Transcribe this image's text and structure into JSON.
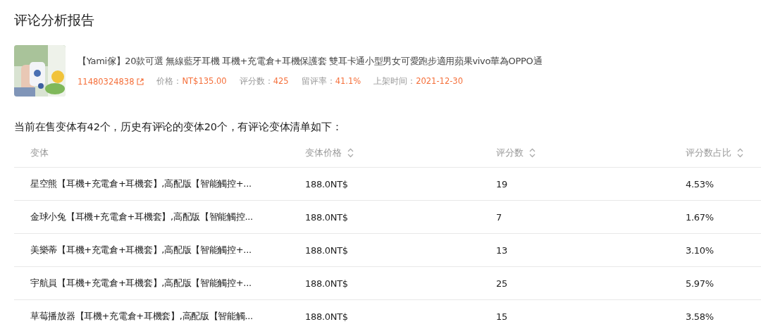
{
  "page_title": "评论分析报告",
  "product": {
    "title": "【Yami傢】20款可選 無線藍牙耳機 耳機+充電倉+耳機保護套 雙耳卡通小型男女可愛跑步適用蘋果vivo華為OPPO通",
    "id": "11480324838",
    "meta": [
      {
        "label": "价格：",
        "value": "NT$135.00"
      },
      {
        "label": "评分数：",
        "value": "425"
      },
      {
        "label": "留评率：",
        "value": "41.1%"
      },
      {
        "label": "上架时间：",
        "value": "2021-12-30"
      }
    ]
  },
  "summary": "当前在售变体有42个，历史有评论的变体20个，有评论变体清单如下：",
  "table": {
    "columns": [
      {
        "label": "变体",
        "sortable": false
      },
      {
        "label": "变体价格",
        "sortable": true
      },
      {
        "label": "评分数",
        "sortable": true
      },
      {
        "label": "评分数占比",
        "sortable": true
      }
    ],
    "rows": [
      [
        "星空熊【耳機+充電倉+耳機套】,高配版【智能觸控+...",
        "188.0NT$",
        "19",
        "4.53%"
      ],
      [
        "金球小兔【耳機+充電倉+耳機套】,高配版【智能觸控...",
        "188.0NT$",
        "7",
        "1.67%"
      ],
      [
        "美樂蒂【耳機+充電倉+耳機套】,高配版【智能觸控+...",
        "188.0NT$",
        "13",
        "3.10%"
      ],
      [
        "宇航員【耳機+充電倉+耳機套】,高配版【智能觸控+...",
        "188.0NT$",
        "25",
        "5.97%"
      ],
      [
        "草莓播放器【耳機+充電倉+耳機套】,高配版【智能觸...",
        "188.0NT$",
        "15",
        "3.58%"
      ]
    ]
  }
}
